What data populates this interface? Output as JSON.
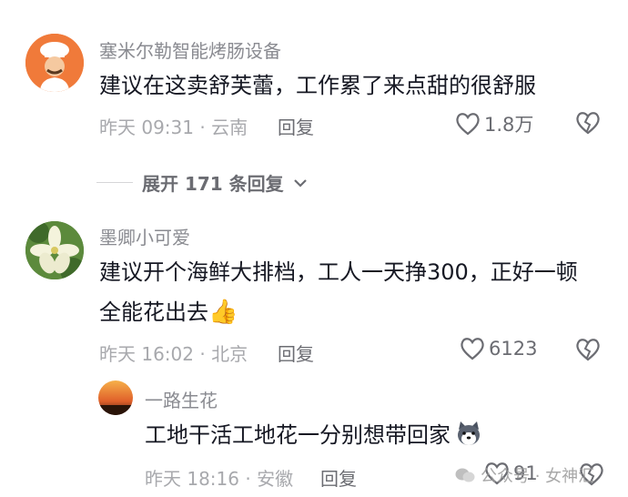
{
  "comments": [
    {
      "username": "塞米尔勒智能烤肠设备",
      "text": "建议在这卖舒芙蕾，工作累了来点甜的很舒服",
      "time": "昨天 09:31 · 云南",
      "reply_label": "回复",
      "likes": "1.8万"
    },
    {
      "username": "墨卿小可爱",
      "text": "建议开个海鲜大排档，工人一天挣300，正好一顿全能花出去",
      "emoji": "👍",
      "time": "昨天 16:02 · 北京",
      "reply_label": "回复",
      "likes": "6123"
    }
  ],
  "expand_replies": "展开 171 条回复",
  "reply": {
    "username": "一路生花",
    "text": "工地干活工地花一分别想带回家",
    "time": "昨天 18:16 · 安徽",
    "reply_label": "回复",
    "likes": "91"
  },
  "watermark": "公众号 · 女神汇",
  "colors": {
    "meta": "#a8a9ad",
    "text": "#161823",
    "name": "#8a8b91"
  }
}
